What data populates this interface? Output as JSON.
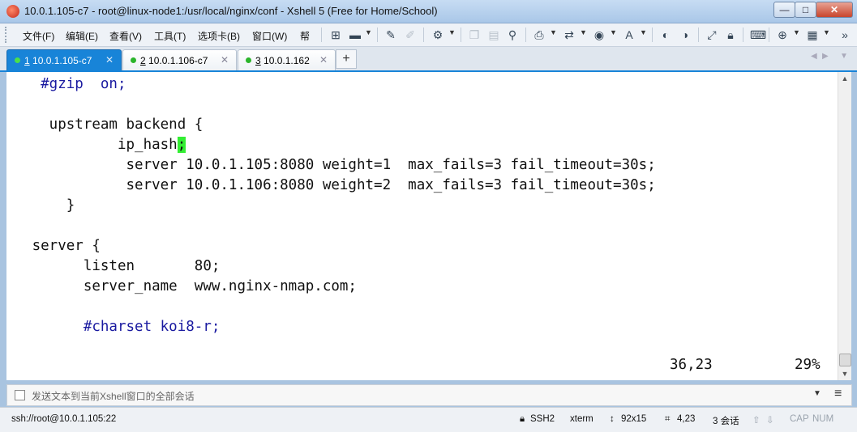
{
  "window": {
    "title": "10.0.1.105-c7 - root@linux-node1:/usr/local/nginx/conf - Xshell 5 (Free for Home/School)",
    "min_label": "—",
    "max_label": "□",
    "close_label": "✕"
  },
  "menu": {
    "items": [
      "文件(F)",
      "编辑(E)",
      "查看(V)",
      "工具(T)",
      "选项卡(B)",
      "窗口(W)",
      "帮"
    ]
  },
  "toolbar": {
    "icons": [
      "new-session-icon",
      "open-folder-icon",
      "reconnect-icon",
      "disconnect-icon",
      "properties-icon",
      "copy-icon",
      "paste-icon",
      "find-icon",
      "print-icon",
      "transfer-icon",
      "globe-icon",
      "font-icon",
      "xftp-icon",
      "xmanager-icon",
      "fullscreen-icon",
      "lock-icon",
      "keyboard-icon",
      "add-icon",
      "layout-icon"
    ]
  },
  "tabs": [
    {
      "num": "1",
      "label": "10.0.1.105-c7",
      "active": true
    },
    {
      "num": "2",
      "label": "10.0.1.106-c7",
      "active": false
    },
    {
      "num": "3",
      "label": "10.0.1.162",
      "active": false
    }
  ],
  "tab_add_label": "+",
  "terminal": {
    "lines": [
      {
        "indent": "    ",
        "text": "#gzip  on;",
        "comment": true
      },
      {
        "indent": "",
        "text": "",
        "comment": false
      },
      {
        "indent": "     ",
        "text": "upstream backend {",
        "comment": false
      },
      {
        "indent": "             ",
        "text": "ip_hash",
        "cursor_char": ";",
        "comment": false
      },
      {
        "indent": "              ",
        "text": "server 10.0.1.105:8080 weight=1  max_fails=3 fail_timeout=30s;",
        "comment": false
      },
      {
        "indent": "              ",
        "text": "server 10.0.1.106:8080 weight=2  max_fails=3 fail_timeout=30s;",
        "comment": false
      },
      {
        "indent": "       ",
        "text": "}",
        "comment": false
      },
      {
        "indent": "",
        "text": "",
        "comment": false
      },
      {
        "indent": "   ",
        "text": "server {",
        "comment": false
      },
      {
        "indent": "         ",
        "text": "listen       80;",
        "comment": false
      },
      {
        "indent": "         ",
        "text": "server_name  www.nginx-nmap.com;",
        "comment": false
      },
      {
        "indent": "",
        "text": "",
        "comment": false
      },
      {
        "indent": "         ",
        "text": "#charset koi8-r;",
        "comment": true
      }
    ],
    "cursor_pos": "36,23",
    "percent": "29%"
  },
  "sendbar": {
    "text": "发送文本到当前Xshell窗口的全部会话"
  },
  "status": {
    "connection": "ssh://root@10.0.1.105:22",
    "protocol": "SSH2",
    "terminal_type": "xterm",
    "size": "92x15",
    "position": "4,23",
    "sessions": "3 会话",
    "caps": "CAP",
    "num": "NUM"
  }
}
